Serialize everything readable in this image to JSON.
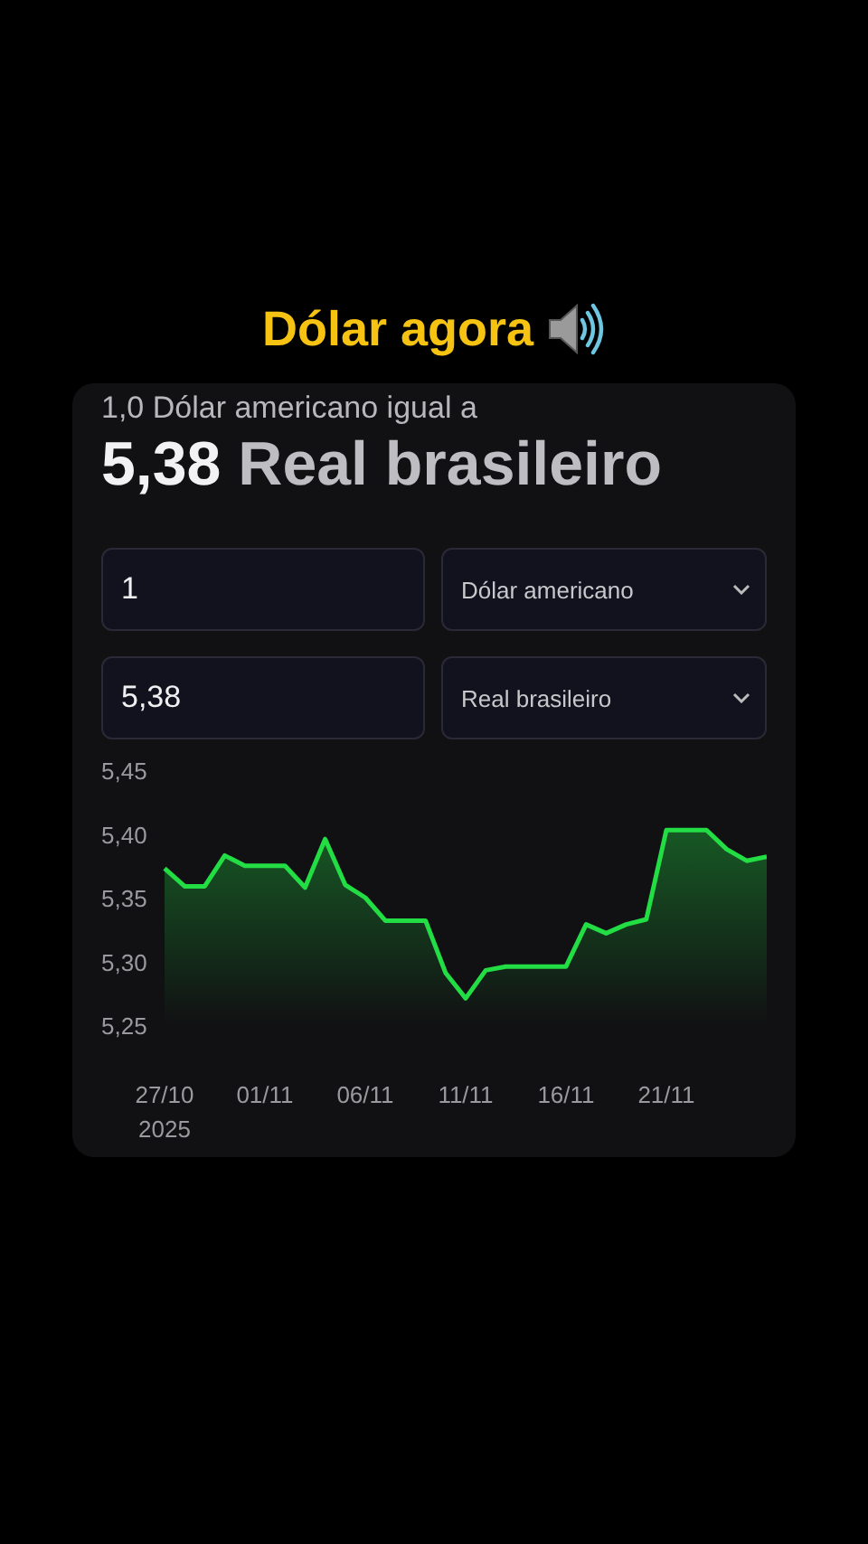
{
  "title": "Dólar agora",
  "converter": {
    "rate_caption": "1,0 Dólar americano igual a",
    "rate_value": "5,38",
    "rate_currency": "Real brasileiro",
    "rows": [
      {
        "amount": "1",
        "currency": "Dólar americano"
      },
      {
        "amount": "5,38",
        "currency": "Real brasileiro"
      }
    ],
    "chart_data": {
      "type": "area",
      "categories": [
        "27/10",
        null,
        null,
        null,
        null,
        "01/11",
        null,
        null,
        null,
        null,
        "06/11",
        null,
        null,
        null,
        null,
        "11/11",
        null,
        null,
        null,
        null,
        "16/11",
        null,
        null,
        null,
        null,
        "21/11",
        null,
        null,
        null,
        null,
        null
      ],
      "series": [
        {
          "color": "#22dd44",
          "values": [
            5.373,
            5.359,
            5.359,
            5.383,
            5.375,
            5.375,
            5.375,
            5.358,
            5.396,
            5.36,
            5.35,
            5.332,
            5.332,
            5.332,
            5.291,
            5.271,
            5.293,
            5.296,
            5.296,
            5.296,
            5.296,
            5.329,
            5.322,
            5.329,
            5.333,
            5.403,
            5.403,
            5.403,
            5.388,
            5.379,
            5.382
          ]
        }
      ],
      "ylim": [
        5.25,
        5.45
      ],
      "yticks": [
        {
          "value": 5.45,
          "label": "5,45"
        },
        {
          "value": 5.4,
          "label": "5,40"
        },
        {
          "value": 5.35,
          "label": "5,35"
        },
        {
          "value": 5.3,
          "label": "5,30"
        },
        {
          "value": 5.25,
          "label": "5,25"
        }
      ],
      "xlabel": "2025"
    }
  }
}
